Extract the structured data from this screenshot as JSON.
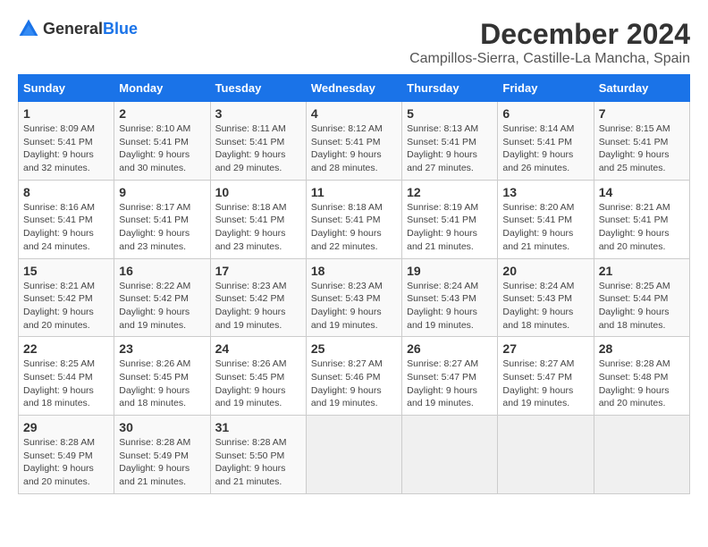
{
  "logo": {
    "text_general": "General",
    "text_blue": "Blue"
  },
  "title": "December 2024",
  "subtitle": "Campillos-Sierra, Castille-La Mancha, Spain",
  "days_of_week": [
    "Sunday",
    "Monday",
    "Tuesday",
    "Wednesday",
    "Thursday",
    "Friday",
    "Saturday"
  ],
  "weeks": [
    [
      {
        "day": "1",
        "sunrise": "Sunrise: 8:09 AM",
        "sunset": "Sunset: 5:41 PM",
        "daylight": "Daylight: 9 hours and 32 minutes."
      },
      {
        "day": "2",
        "sunrise": "Sunrise: 8:10 AM",
        "sunset": "Sunset: 5:41 PM",
        "daylight": "Daylight: 9 hours and 30 minutes."
      },
      {
        "day": "3",
        "sunrise": "Sunrise: 8:11 AM",
        "sunset": "Sunset: 5:41 PM",
        "daylight": "Daylight: 9 hours and 29 minutes."
      },
      {
        "day": "4",
        "sunrise": "Sunrise: 8:12 AM",
        "sunset": "Sunset: 5:41 PM",
        "daylight": "Daylight: 9 hours and 28 minutes."
      },
      {
        "day": "5",
        "sunrise": "Sunrise: 8:13 AM",
        "sunset": "Sunset: 5:41 PM",
        "daylight": "Daylight: 9 hours and 27 minutes."
      },
      {
        "day": "6",
        "sunrise": "Sunrise: 8:14 AM",
        "sunset": "Sunset: 5:41 PM",
        "daylight": "Daylight: 9 hours and 26 minutes."
      },
      {
        "day": "7",
        "sunrise": "Sunrise: 8:15 AM",
        "sunset": "Sunset: 5:41 PM",
        "daylight": "Daylight: 9 hours and 25 minutes."
      }
    ],
    [
      {
        "day": "8",
        "sunrise": "Sunrise: 8:16 AM",
        "sunset": "Sunset: 5:41 PM",
        "daylight": "Daylight: 9 hours and 24 minutes."
      },
      {
        "day": "9",
        "sunrise": "Sunrise: 8:17 AM",
        "sunset": "Sunset: 5:41 PM",
        "daylight": "Daylight: 9 hours and 23 minutes."
      },
      {
        "day": "10",
        "sunrise": "Sunrise: 8:18 AM",
        "sunset": "Sunset: 5:41 PM",
        "daylight": "Daylight: 9 hours and 23 minutes."
      },
      {
        "day": "11",
        "sunrise": "Sunrise: 8:18 AM",
        "sunset": "Sunset: 5:41 PM",
        "daylight": "Daylight: 9 hours and 22 minutes."
      },
      {
        "day": "12",
        "sunrise": "Sunrise: 8:19 AM",
        "sunset": "Sunset: 5:41 PM",
        "daylight": "Daylight: 9 hours and 21 minutes."
      },
      {
        "day": "13",
        "sunrise": "Sunrise: 8:20 AM",
        "sunset": "Sunset: 5:41 PM",
        "daylight": "Daylight: 9 hours and 21 minutes."
      },
      {
        "day": "14",
        "sunrise": "Sunrise: 8:21 AM",
        "sunset": "Sunset: 5:41 PM",
        "daylight": "Daylight: 9 hours and 20 minutes."
      }
    ],
    [
      {
        "day": "15",
        "sunrise": "Sunrise: 8:21 AM",
        "sunset": "Sunset: 5:42 PM",
        "daylight": "Daylight: 9 hours and 20 minutes."
      },
      {
        "day": "16",
        "sunrise": "Sunrise: 8:22 AM",
        "sunset": "Sunset: 5:42 PM",
        "daylight": "Daylight: 9 hours and 19 minutes."
      },
      {
        "day": "17",
        "sunrise": "Sunrise: 8:23 AM",
        "sunset": "Sunset: 5:42 PM",
        "daylight": "Daylight: 9 hours and 19 minutes."
      },
      {
        "day": "18",
        "sunrise": "Sunrise: 8:23 AM",
        "sunset": "Sunset: 5:43 PM",
        "daylight": "Daylight: 9 hours and 19 minutes."
      },
      {
        "day": "19",
        "sunrise": "Sunrise: 8:24 AM",
        "sunset": "Sunset: 5:43 PM",
        "daylight": "Daylight: 9 hours and 19 minutes."
      },
      {
        "day": "20",
        "sunrise": "Sunrise: 8:24 AM",
        "sunset": "Sunset: 5:43 PM",
        "daylight": "Daylight: 9 hours and 18 minutes."
      },
      {
        "day": "21",
        "sunrise": "Sunrise: 8:25 AM",
        "sunset": "Sunset: 5:44 PM",
        "daylight": "Daylight: 9 hours and 18 minutes."
      }
    ],
    [
      {
        "day": "22",
        "sunrise": "Sunrise: 8:25 AM",
        "sunset": "Sunset: 5:44 PM",
        "daylight": "Daylight: 9 hours and 18 minutes."
      },
      {
        "day": "23",
        "sunrise": "Sunrise: 8:26 AM",
        "sunset": "Sunset: 5:45 PM",
        "daylight": "Daylight: 9 hours and 18 minutes."
      },
      {
        "day": "24",
        "sunrise": "Sunrise: 8:26 AM",
        "sunset": "Sunset: 5:45 PM",
        "daylight": "Daylight: 9 hours and 19 minutes."
      },
      {
        "day": "25",
        "sunrise": "Sunrise: 8:27 AM",
        "sunset": "Sunset: 5:46 PM",
        "daylight": "Daylight: 9 hours and 19 minutes."
      },
      {
        "day": "26",
        "sunrise": "Sunrise: 8:27 AM",
        "sunset": "Sunset: 5:47 PM",
        "daylight": "Daylight: 9 hours and 19 minutes."
      },
      {
        "day": "27",
        "sunrise": "Sunrise: 8:27 AM",
        "sunset": "Sunset: 5:47 PM",
        "daylight": "Daylight: 9 hours and 19 minutes."
      },
      {
        "day": "28",
        "sunrise": "Sunrise: 8:28 AM",
        "sunset": "Sunset: 5:48 PM",
        "daylight": "Daylight: 9 hours and 20 minutes."
      }
    ],
    [
      {
        "day": "29",
        "sunrise": "Sunrise: 8:28 AM",
        "sunset": "Sunset: 5:49 PM",
        "daylight": "Daylight: 9 hours and 20 minutes."
      },
      {
        "day": "30",
        "sunrise": "Sunrise: 8:28 AM",
        "sunset": "Sunset: 5:49 PM",
        "daylight": "Daylight: 9 hours and 21 minutes."
      },
      {
        "day": "31",
        "sunrise": "Sunrise: 8:28 AM",
        "sunset": "Sunset: 5:50 PM",
        "daylight": "Daylight: 9 hours and 21 minutes."
      },
      null,
      null,
      null,
      null
    ]
  ]
}
